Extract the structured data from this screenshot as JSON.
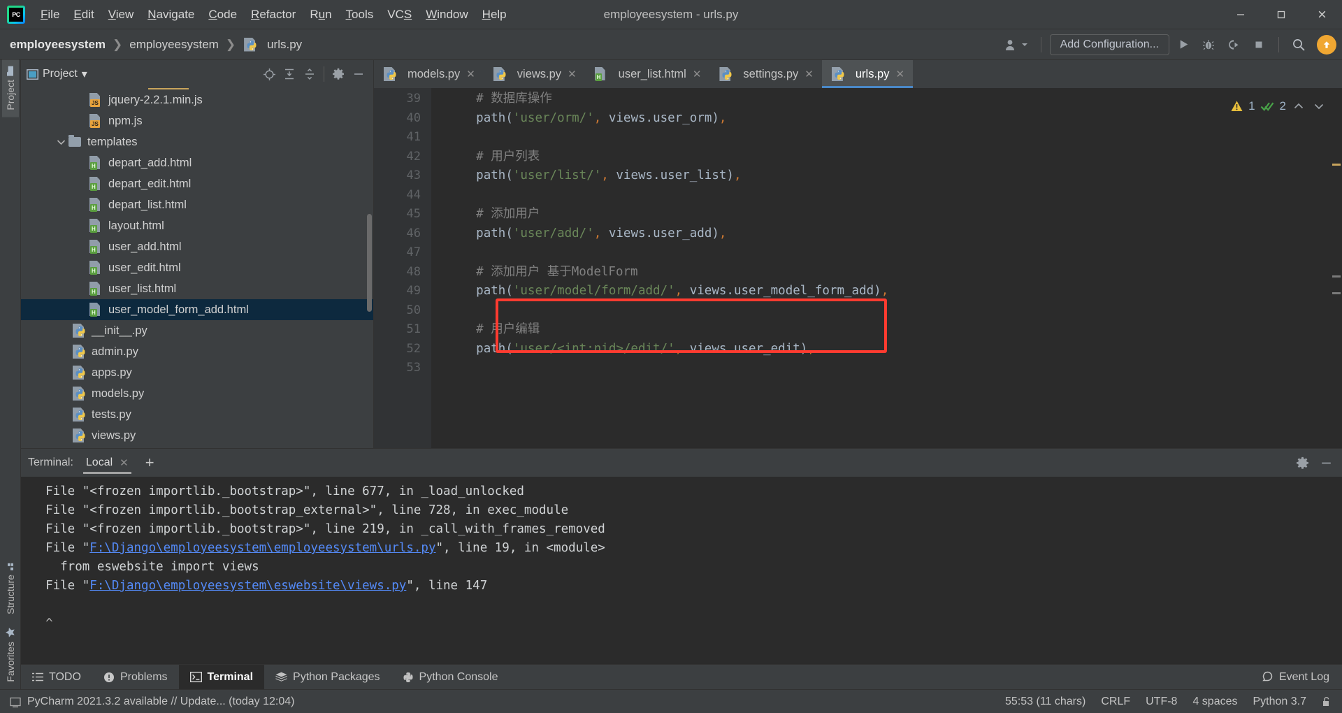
{
  "window": {
    "title": "employeesystem - urls.py",
    "minimize_label": "—",
    "maximize_label": "❐",
    "close_label": "✕"
  },
  "menubar": {
    "logo_text": "PC",
    "items": [
      {
        "pre": "",
        "mn": "F",
        "post": "ile",
        "name": "menu-file"
      },
      {
        "pre": "",
        "mn": "E",
        "post": "dit",
        "name": "menu-edit"
      },
      {
        "pre": "",
        "mn": "V",
        "post": "iew",
        "name": "menu-view"
      },
      {
        "pre": "",
        "mn": "N",
        "post": "avigate",
        "name": "menu-navigate"
      },
      {
        "pre": "",
        "mn": "C",
        "post": "ode",
        "name": "menu-code"
      },
      {
        "pre": "",
        "mn": "R",
        "post": "efactor",
        "name": "menu-refactor"
      },
      {
        "pre": "R",
        "mn": "u",
        "post": "n",
        "name": "menu-run"
      },
      {
        "pre": "",
        "mn": "T",
        "post": "ools",
        "name": "menu-tools"
      },
      {
        "pre": "VC",
        "mn": "S",
        "post": "",
        "name": "menu-vcs"
      },
      {
        "pre": "",
        "mn": "W",
        "post": "indow",
        "name": "menu-window"
      },
      {
        "pre": "",
        "mn": "H",
        "post": "elp",
        "name": "menu-help"
      }
    ]
  },
  "navbar": {
    "breadcrumb": [
      {
        "label": "employeesystem",
        "bold": true,
        "icon": "none"
      },
      {
        "label": "employeesystem",
        "bold": false,
        "icon": "none"
      },
      {
        "label": "urls.py",
        "bold": false,
        "icon": "python-file-icon"
      }
    ],
    "separator": "❯",
    "add_configuration_label": "Add Configuration...",
    "buttons": [
      {
        "name": "run-button",
        "icon": "run-icon"
      },
      {
        "name": "debug-button",
        "icon": "bug-icon"
      },
      {
        "name": "coverage-button",
        "icon": "coverage-icon"
      },
      {
        "name": "stop-button",
        "icon": "stop-icon"
      },
      {
        "name": "search-everywhere-button",
        "icon": "search-icon"
      },
      {
        "name": "update-button",
        "icon": "arrow-up-icon"
      }
    ]
  },
  "left_strip": {
    "tabs": [
      {
        "label": "Project",
        "icon": "folder-icon",
        "active": true
      },
      {
        "label": "Structure",
        "icon": "structure-icon",
        "active": false
      },
      {
        "label": "Favorites",
        "icon": "star-icon",
        "active": false
      }
    ]
  },
  "project_panel": {
    "title": "Project",
    "dropdown_caret": "▾",
    "toolbar_icons": [
      {
        "name": "locate-file-icon"
      },
      {
        "name": "expand-all-icon"
      },
      {
        "name": "collapse-all-icon"
      },
      {
        "name": "gear-icon"
      },
      {
        "name": "hide-icon"
      }
    ],
    "tree": [
      {
        "label": "jquery-2.2.1.min.js",
        "indent": 4,
        "icon": "js-file-icon",
        "chevron": "",
        "selected": false
      },
      {
        "label": "npm.js",
        "indent": 4,
        "icon": "js-file-icon",
        "chevron": "",
        "selected": false
      },
      {
        "label": "templates",
        "indent": 2,
        "icon": "folder-icon",
        "chevron": "v",
        "selected": false
      },
      {
        "label": "depart_add.html",
        "indent": 4,
        "icon": "html-file-icon",
        "chevron": "",
        "selected": false
      },
      {
        "label": "depart_edit.html",
        "indent": 4,
        "icon": "html-file-icon",
        "chevron": "",
        "selected": false
      },
      {
        "label": "depart_list.html",
        "indent": 4,
        "icon": "html-file-icon",
        "chevron": "",
        "selected": false
      },
      {
        "label": "layout.html",
        "indent": 4,
        "icon": "html-file-icon",
        "chevron": "",
        "selected": false
      },
      {
        "label": "user_add.html",
        "indent": 4,
        "icon": "html-file-icon",
        "chevron": "",
        "selected": false
      },
      {
        "label": "user_edit.html",
        "indent": 4,
        "icon": "html-file-icon",
        "chevron": "",
        "selected": false
      },
      {
        "label": "user_list.html",
        "indent": 4,
        "icon": "html-file-icon",
        "chevron": "",
        "selected": false
      },
      {
        "label": "user_model_form_add.html",
        "indent": 4,
        "icon": "html-file-icon",
        "chevron": "",
        "selected": true
      },
      {
        "label": "__init__.py",
        "indent": 3,
        "icon": "python-file-icon",
        "chevron": "",
        "selected": false
      },
      {
        "label": "admin.py",
        "indent": 3,
        "icon": "python-file-icon",
        "chevron": "",
        "selected": false
      },
      {
        "label": "apps.py",
        "indent": 3,
        "icon": "python-file-icon",
        "chevron": "",
        "selected": false
      },
      {
        "label": "models.py",
        "indent": 3,
        "icon": "python-file-icon",
        "chevron": "",
        "selected": false
      },
      {
        "label": "tests.py",
        "indent": 3,
        "icon": "python-file-icon",
        "chevron": "",
        "selected": false
      },
      {
        "label": "views.py",
        "indent": 3,
        "icon": "python-file-icon",
        "chevron": "",
        "selected": false
      }
    ]
  },
  "editor": {
    "tabs": [
      {
        "label": "models.py",
        "icon": "python-file-icon",
        "active": false
      },
      {
        "label": "views.py",
        "icon": "python-file-icon",
        "active": false
      },
      {
        "label": "user_list.html",
        "icon": "html-file-icon",
        "active": false
      },
      {
        "label": "settings.py",
        "icon": "python-file-icon",
        "active": false
      },
      {
        "label": "urls.py",
        "icon": "python-file-icon",
        "active": true
      }
    ],
    "tab_close_glyph": "✕",
    "inspection": {
      "warning_count": "1",
      "ok_count": "2",
      "prev_glyph": "⌃",
      "next_glyph": "⌄"
    },
    "first_line_number": 39,
    "lines": [
      {
        "n": 39,
        "tokens": [
          {
            "t": "    # 数据库操作",
            "c": "k-cmt"
          }
        ]
      },
      {
        "n": 40,
        "tokens": [
          {
            "t": "    ",
            "c": ""
          },
          {
            "t": "path",
            "c": "k-fn"
          },
          {
            "t": "(",
            "c": "k-punc"
          },
          {
            "t": "'user/orm/'",
            "c": "k-str"
          },
          {
            "t": ",",
            "c": "k-comma"
          },
          {
            "t": " views.user_orm",
            "c": "k-fn"
          },
          {
            "t": ")",
            "c": "k-punc"
          },
          {
            "t": ",",
            "c": "k-comma"
          }
        ]
      },
      {
        "n": 41,
        "tokens": []
      },
      {
        "n": 42,
        "tokens": [
          {
            "t": "    # 用户列表",
            "c": "k-cmt"
          }
        ]
      },
      {
        "n": 43,
        "tokens": [
          {
            "t": "    ",
            "c": ""
          },
          {
            "t": "path",
            "c": "k-fn"
          },
          {
            "t": "(",
            "c": "k-punc"
          },
          {
            "t": "'user/list/'",
            "c": "k-str"
          },
          {
            "t": ",",
            "c": "k-comma"
          },
          {
            "t": " views.user_list",
            "c": "k-fn"
          },
          {
            "t": ")",
            "c": "k-punc"
          },
          {
            "t": ",",
            "c": "k-comma"
          }
        ]
      },
      {
        "n": 44,
        "tokens": []
      },
      {
        "n": 45,
        "tokens": [
          {
            "t": "    # 添加用户",
            "c": "k-cmt"
          }
        ]
      },
      {
        "n": 46,
        "tokens": [
          {
            "t": "    ",
            "c": ""
          },
          {
            "t": "path",
            "c": "k-fn"
          },
          {
            "t": "(",
            "c": "k-punc"
          },
          {
            "t": "'user/add/'",
            "c": "k-str"
          },
          {
            "t": ",",
            "c": "k-comma"
          },
          {
            "t": " views.user_add",
            "c": "k-fn"
          },
          {
            "t": ")",
            "c": "k-punc"
          },
          {
            "t": ",",
            "c": "k-comma"
          }
        ]
      },
      {
        "n": 47,
        "tokens": []
      },
      {
        "n": 48,
        "tokens": [
          {
            "t": "    # 添加用户 基于ModelForm",
            "c": "k-cmt"
          }
        ]
      },
      {
        "n": 49,
        "tokens": [
          {
            "t": "    ",
            "c": ""
          },
          {
            "t": "path",
            "c": "k-fn"
          },
          {
            "t": "(",
            "c": "k-punc"
          },
          {
            "t": "'user/model/form/add/'",
            "c": "k-str"
          },
          {
            "t": ",",
            "c": "k-comma"
          },
          {
            "t": " views.user_model_form_add",
            "c": "k-fn"
          },
          {
            "t": ")",
            "c": "k-punc"
          },
          {
            "t": ",",
            "c": "k-comma"
          }
        ]
      },
      {
        "n": 50,
        "tokens": []
      },
      {
        "n": 51,
        "tokens": [
          {
            "t": "    # 用户编辑",
            "c": "k-cmt"
          }
        ]
      },
      {
        "n": 52,
        "tokens": [
          {
            "t": "    ",
            "c": ""
          },
          {
            "t": "path",
            "c": "k-fn"
          },
          {
            "t": "(",
            "c": "k-punc"
          },
          {
            "t": "'user/<int:nid>/edit/'",
            "c": "k-str"
          },
          {
            "t": ",",
            "c": "k-comma"
          },
          {
            "t": " views.user_edit",
            "c": "k-fn"
          },
          {
            "t": ")",
            "c": "k-punc"
          },
          {
            "t": ",",
            "c": "k-comma"
          }
        ]
      },
      {
        "n": 53,
        "tokens": []
      }
    ],
    "annotation": {
      "color": "#ff3b30",
      "type": "red-rectangle",
      "covers_lines": [
        51,
        52
      ]
    }
  },
  "terminal": {
    "label": "Terminal:",
    "tab_label": "Local",
    "tab_close_glyph": "✕",
    "add_glyph": "+",
    "settings_icon": "gear-icon",
    "hide_icon": "hide-icon",
    "lines": [
      {
        "parts": [
          {
            "t": "  File ",
            "c": "tq"
          },
          {
            "t": "\"<frozen importlib._bootstrap>\"",
            "c": "tq"
          },
          {
            "t": ", line 677, in _load_unlocked",
            "c": "tq"
          }
        ]
      },
      {
        "parts": [
          {
            "t": "  File ",
            "c": "tq"
          },
          {
            "t": "\"<frozen importlib._bootstrap_external>\"",
            "c": "tq"
          },
          {
            "t": ", line 728, in exec_module",
            "c": "tq"
          }
        ]
      },
      {
        "parts": [
          {
            "t": "  File ",
            "c": "tq"
          },
          {
            "t": "\"<frozen importlib._bootstrap>\"",
            "c": "tq"
          },
          {
            "t": ", line 219, in _call_with_frames_removed",
            "c": "tq"
          }
        ]
      },
      {
        "parts": [
          {
            "t": "  File \"",
            "c": "tq"
          },
          {
            "t": "F:\\Django\\employeesystem\\employeesystem\\urls.py",
            "c": "tlink"
          },
          {
            "t": "\", line 19, in <module>",
            "c": "tq"
          }
        ]
      },
      {
        "parts": [
          {
            "t": "    from eswebsite import views",
            "c": "tq"
          }
        ]
      },
      {
        "parts": [
          {
            "t": "  File \"",
            "c": "tq"
          },
          {
            "t": "F:\\Django\\employeesystem\\eswebsite\\views.py",
            "c": "tlink"
          },
          {
            "t": "\", line 147",
            "c": "tq"
          }
        ]
      },
      {
        "parts": []
      },
      {
        "parts": [
          {
            "t": "  ^",
            "c": "prompt-caret"
          }
        ]
      }
    ]
  },
  "bottom_bar": {
    "tabs": [
      {
        "label": "TODO",
        "icon": "todo-icon",
        "active": false
      },
      {
        "label": "Problems",
        "icon": "problems-icon",
        "active": false
      },
      {
        "label": "Terminal",
        "icon": "terminal-icon",
        "active": true
      },
      {
        "label": "Python Packages",
        "icon": "packages-icon",
        "active": false
      },
      {
        "label": "Python Console",
        "icon": "python-icon",
        "active": false
      }
    ],
    "event_log_label": "Event Log",
    "event_log_icon": "event-log-icon"
  },
  "status_bar": {
    "message": "PyCharm 2021.3.2 available // Update... (today 12:04)",
    "message_icon": "ide-update-icon",
    "caret_position": "55:53 (11 chars)",
    "line_separator": "CRLF",
    "encoding": "UTF-8",
    "indent": "4 spaces",
    "interpreter": "Python 3.7",
    "lock_icon": "unlocked-icon"
  },
  "colors": {
    "accent_blue": "#4a88c7",
    "annotation_red": "#ff3b30",
    "update_orange": "#f0a732",
    "selection_blue": "#0d293e",
    "link_blue": "#548af7"
  }
}
